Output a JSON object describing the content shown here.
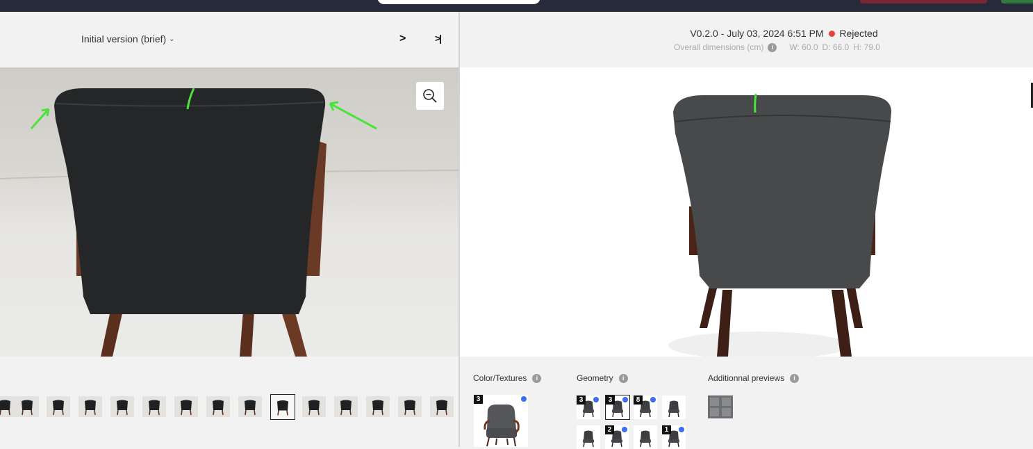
{
  "left_panel": {
    "version_label": "Initial version (brief)",
    "next_label": ">",
    "last_label": ">|",
    "thumbnail_count": 15,
    "selected_thumbnail": 9
  },
  "right_panel": {
    "version": "V0.2.0",
    "separator": "-",
    "date": "July 03, 2024 6:51 PM",
    "status": "Rejected",
    "status_color": "#e8423a",
    "dimensions_label": "Overall dimensions (cm)",
    "width": "W: 60.0",
    "depth": "D: 66.0",
    "height": "H: 79.0"
  },
  "sections": {
    "color_textures": {
      "label": "Color/Textures",
      "badge": "3"
    },
    "geometry": {
      "label": "Geometry",
      "tiles": [
        {
          "badge": "3",
          "dot": true
        },
        {
          "badge": "3",
          "dot": true
        },
        {
          "badge": "8",
          "dot": true
        },
        {
          "badge": "",
          "dot": false
        },
        {
          "badge": "",
          "dot": false
        },
        {
          "badge": "2",
          "dot": true
        },
        {
          "badge": "",
          "dot": false
        },
        {
          "badge": "1",
          "dot": true
        }
      ]
    },
    "additional": {
      "label": "Additionnal previews"
    }
  },
  "info_icon": "i",
  "colors": {
    "accent_dot": "#3d6cf0",
    "annotation_green": "#4be33a",
    "topbar": "#262a3a"
  }
}
